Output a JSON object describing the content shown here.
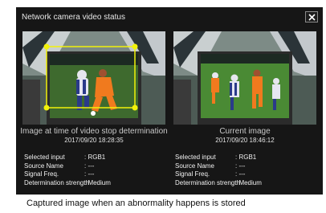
{
  "dialog": {
    "title": "Network camera video status",
    "close_icon": "close-icon"
  },
  "left": {
    "heading": "Image at time of video stop determination",
    "timestamp": "2017/09/20 18:28:35",
    "info": [
      {
        "label": "Selected input",
        "value": ": RGB1"
      },
      {
        "label": "Source Name",
        "value": ": ---"
      },
      {
        "label": "Signal Freq.",
        "value": ": ---"
      },
      {
        "label": "Determination strength",
        "value": ": Medium"
      }
    ]
  },
  "right": {
    "heading": "Current image",
    "timestamp": "2017/09/20 18:46:12",
    "info": [
      {
        "label": "Selected input",
        "value": ": RGB1"
      },
      {
        "label": "Source Name",
        "value": ": ---"
      },
      {
        "label": "Signal Freq.",
        "value": ": ---"
      },
      {
        "label": "Determination strength",
        "value": ": Medium"
      }
    ]
  },
  "colors": {
    "highlight": "#f2f20a",
    "dialog_bg": "#161616"
  },
  "caption": "Captured image when an abnormality happens is stored"
}
